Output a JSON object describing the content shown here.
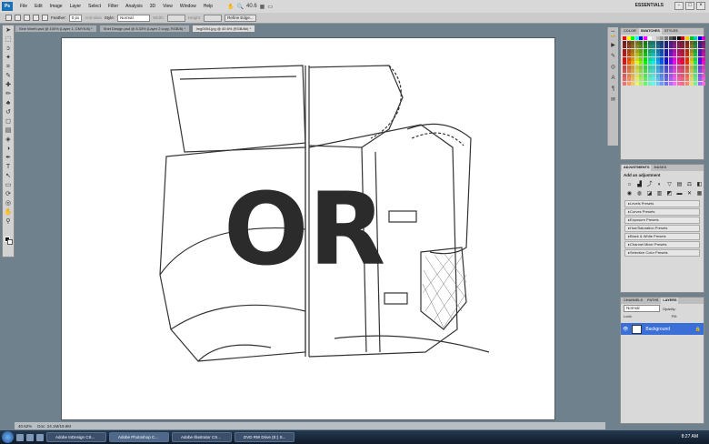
{
  "app": {
    "logo": "Ps",
    "workspace": "ESSENTIALS",
    "zoom_menu": "40.6",
    "win_controls": [
      "-",
      "□",
      "×"
    ]
  },
  "menu": [
    "File",
    "Edit",
    "Image",
    "Layer",
    "Select",
    "Filter",
    "Analysis",
    "3D",
    "View",
    "Window",
    "Help"
  ],
  "options": {
    "feather_label": "Feather:",
    "feather_value": "0 px",
    "antialias": "Anti-alias",
    "style_label": "Style:",
    "style_value": "Normal",
    "width_label": "Width:",
    "height_label": "Height:",
    "refine_edge": "Refine Edge..."
  },
  "tabs": [
    {
      "label": "Sine Worth.psd @ 100% (Layer 1, CMYK/8) *",
      "active": false
    },
    {
      "label": "Shirt Design.psd @ 8.33% (Layer 2 copy, RGB/8) *",
      "active": false
    },
    {
      "label": "img0004.jpg @ 40.6% (RGB/8#) *",
      "active": true
    }
  ],
  "status": {
    "zoom": "40.62%",
    "doc": "Doc: 24.1M/19.6M"
  },
  "artwork": {
    "letters": "OR"
  },
  "panels": {
    "swatches": {
      "tabs": [
        "COLOR",
        "SWATCHES",
        "STYLES"
      ],
      "active": 1
    },
    "adjustments": {
      "tabs": [
        "ADJUSTMENTS",
        "MASKS"
      ],
      "title": "Add an adjustment",
      "presets": [
        "Levels Presets",
        "Curves Presets",
        "Exposure Presets",
        "Hue/Saturation Presets",
        "Black & White Presets",
        "Channel Mixer Presets",
        "Selective Color Presets"
      ]
    },
    "layers": {
      "tabs": [
        "CHANNELS",
        "PATHS",
        "LAYERS"
      ],
      "blend": "Normal",
      "opacity_label": "Opacity:",
      "fill_label": "Fill:",
      "lock_label": "Lock:",
      "layer": "Background"
    }
  },
  "taskbar": {
    "items": [
      "Adobe InDesign CS...",
      "Adobe Photoshop C...",
      "Adobe Illustrator CS...",
      "DVD RW Drive (E:) S..."
    ],
    "clock": "8:27 AM"
  },
  "tools_icons": [
    "move-icon",
    "marquee-icon",
    "lasso-icon",
    "wand-icon",
    "crop-icon",
    "eyedropper-icon",
    "heal-icon",
    "brush-icon",
    "stamp-icon",
    "history-brush-icon",
    "eraser-icon",
    "gradient-icon",
    "blur-icon",
    "dodge-icon",
    "pen-icon",
    "type-icon",
    "path-select-icon",
    "shape-icon",
    "3d-rotate-icon",
    "3d-camera-icon",
    "hand-icon",
    "zoom-icon"
  ]
}
